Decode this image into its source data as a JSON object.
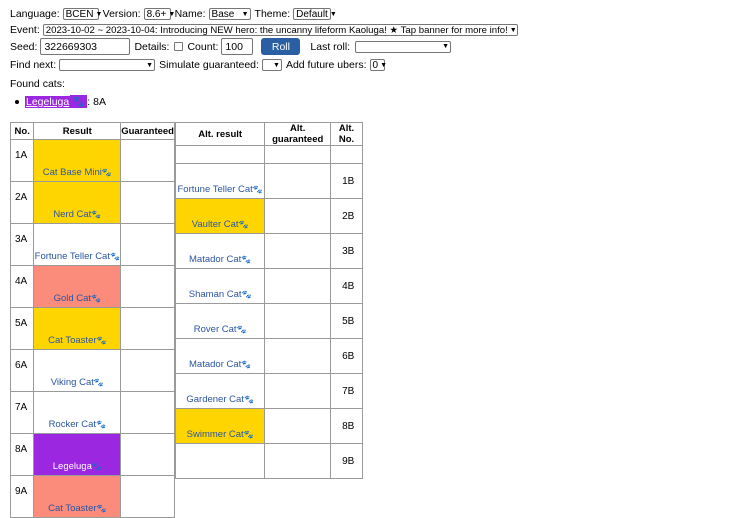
{
  "controls": {
    "language_label": "Language:",
    "language_value": "BCEN",
    "version_label": "Version:",
    "version_value": "8.6+",
    "name_label": "Name:",
    "name_value": "Base",
    "theme_label": "Theme:",
    "theme_value": "Default",
    "event_label": "Event:",
    "event_value": "2023-10-02 ~ 2023-10-04: Introducing NEW hero: the uncanny lifeform Kaoluga! ★ Tap banner for more info!",
    "seed_label": "Seed:",
    "seed_value": "322669303",
    "details_label": "Details:",
    "count_label": "Count:",
    "count_value": "100",
    "roll_label": "Roll",
    "last_roll_label": "Last roll:",
    "last_roll_value": "",
    "find_next_label": "Find next:",
    "find_next_value": "",
    "simulate_label": "Simulate guaranteed:",
    "simulate_value": "",
    "future_ubers_label": "Add future ubers:",
    "future_ubers_value": "0"
  },
  "found": {
    "label": "Found cats:",
    "items": [
      {
        "name": "Legeluga",
        "badge": "🐾",
        "pos": ": 8A"
      }
    ]
  },
  "table": {
    "headers": {
      "no": "No.",
      "result": "Result",
      "guaranteed": "Guaranteed",
      "alt_result": "Alt. result",
      "alt_guaranteed": "Alt. guaranteed",
      "alt_no": "Alt. No."
    },
    "paw": "🐾",
    "rows_a": [
      {
        "no": "1A",
        "cat": "Cat Base Mini",
        "color": "yellow"
      },
      {
        "no": "2A",
        "cat": "Nerd Cat",
        "color": "yellow"
      },
      {
        "no": "3A",
        "cat": "Fortune Teller Cat",
        "color": "white"
      },
      {
        "no": "4A",
        "cat": "Gold Cat",
        "color": "salmon"
      },
      {
        "no": "5A",
        "cat": "Cat Toaster",
        "color": "yellow"
      },
      {
        "no": "6A",
        "cat": "Viking Cat",
        "color": "white"
      },
      {
        "no": "7A",
        "cat": "Rocker Cat",
        "color": "white"
      },
      {
        "no": "8A",
        "cat": "Legeluga",
        "color": "purple"
      },
      {
        "no": "9A",
        "cat": "Cat Toaster",
        "color": "salmon"
      }
    ],
    "rows_b": [
      {
        "no": "1B",
        "cat": "Fortune Teller Cat",
        "color": "white"
      },
      {
        "no": "2B",
        "cat": "Vaulter Cat",
        "color": "yellow"
      },
      {
        "no": "3B",
        "cat": "Matador Cat",
        "color": "white"
      },
      {
        "no": "4B",
        "cat": "Shaman Cat",
        "color": "white"
      },
      {
        "no": "5B",
        "cat": "Rover Cat",
        "color": "white"
      },
      {
        "no": "6B",
        "cat": "Matador Cat",
        "color": "white"
      },
      {
        "no": "7B",
        "cat": "Gardener Cat",
        "color": "white"
      },
      {
        "no": "8B",
        "cat": "Swimmer Cat",
        "color": "yellow"
      },
      {
        "no": "9B",
        "cat": "",
        "color": "white"
      }
    ]
  }
}
